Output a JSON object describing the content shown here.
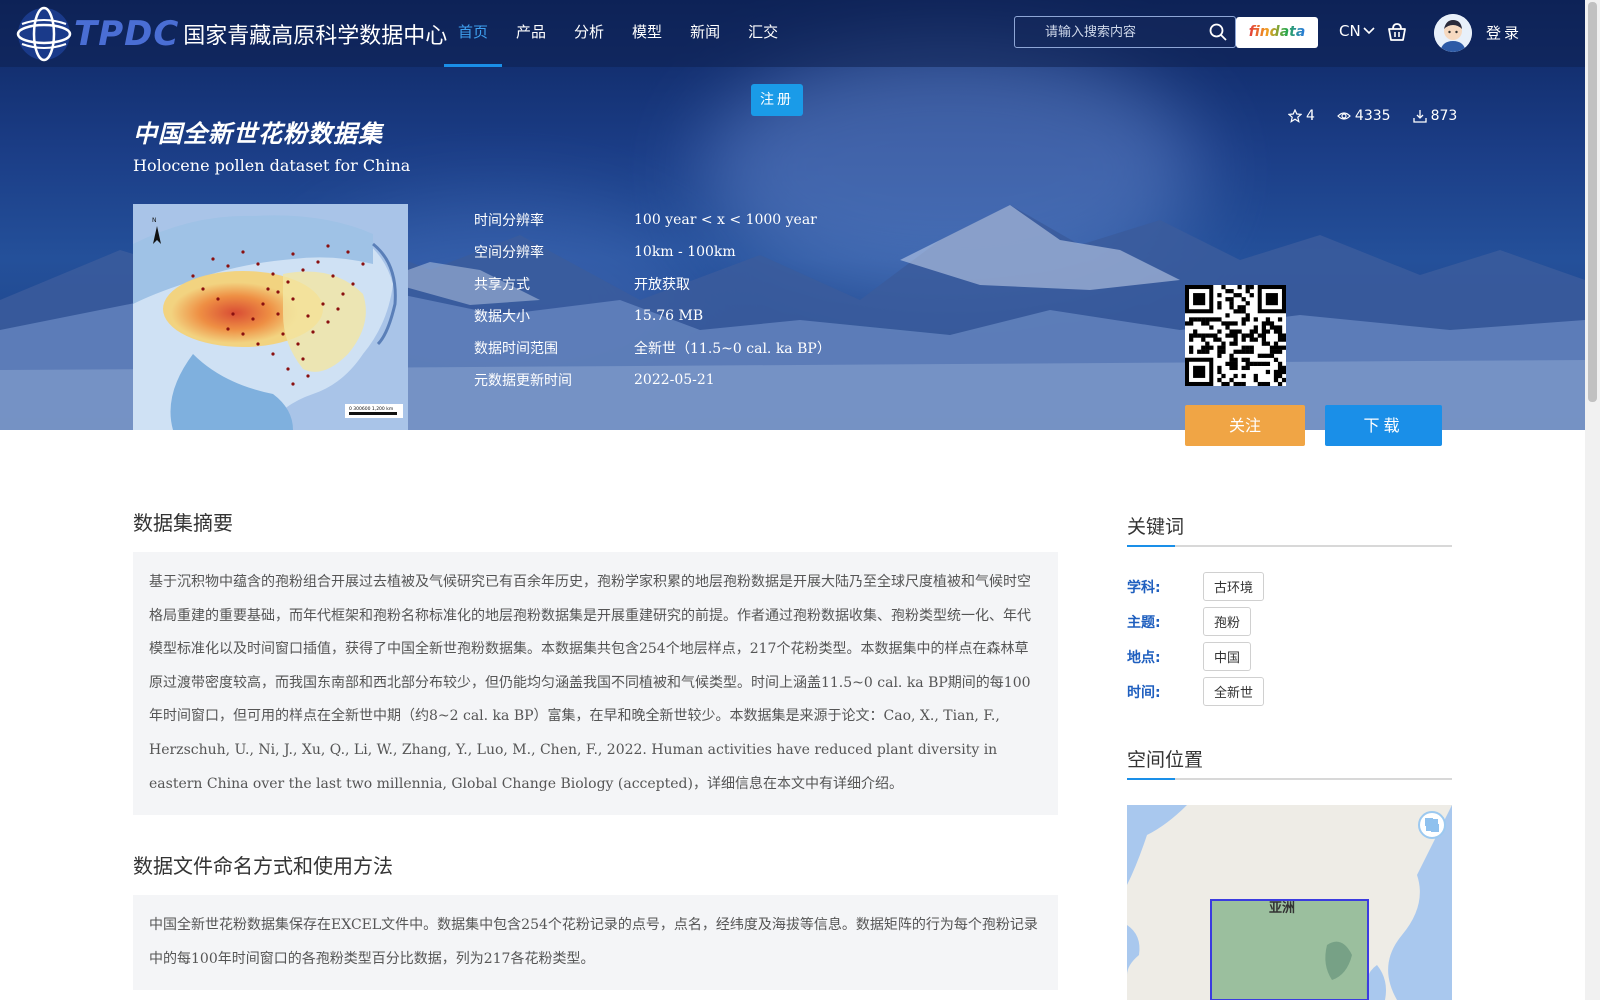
{
  "nav": {
    "logo_abbr": "TPDC",
    "logo_name": "国家青藏高原科学数据中心",
    "menu": [
      {
        "label": "首页",
        "active": true
      },
      {
        "label": "产品",
        "active": false
      },
      {
        "label": "分析",
        "active": false
      },
      {
        "label": "模型",
        "active": false
      },
      {
        "label": "新闻",
        "active": false
      },
      {
        "label": "汇交",
        "active": false
      }
    ],
    "search_placeholder": "请输入搜索内容",
    "findata_label": "findata",
    "lang": "CN",
    "login": "登录"
  },
  "register_label": "注册",
  "dataset": {
    "title_cn": "中国全新世花粉数据集",
    "title_en": "Holocene pollen dataset for China",
    "stars": "4",
    "views": "4335",
    "downloads": "873",
    "meta": [
      {
        "label": "时间分辨率",
        "value": "100 year < x < 1000 year"
      },
      {
        "label": "空间分辨率",
        "value": "10km - 100km"
      },
      {
        "label": "共享方式",
        "value": "开放获取"
      },
      {
        "label": "数据大小",
        "value": "15.76 MB"
      },
      {
        "label": "数据时间范围",
        "value": "全新世（11.5~0 cal. ka BP）"
      },
      {
        "label": "元数据更新时间",
        "value": "2022-05-21"
      }
    ],
    "thumb_scale": "0 300600 1,200 km",
    "follow_label": "关注",
    "download_label": "下载"
  },
  "abstract": {
    "title": "数据集摘要",
    "text": "基于沉积物中蕴含的孢粉组合开展过去植被及气候研究已有百余年历史，孢粉学家积累的地层孢粉数据是开展大陆乃至全球尺度植被和气候时空格局重建的重要基础，而年代框架和孢粉名称标准化的地层孢粉数据集是开展重建研究的前提。作者通过孢粉数据收集、孢粉类型统一化、年代模型标准化以及时间窗口插值，获得了中国全新世孢粉数据集。本数据集共包含254个地层样点，217个花粉类型。本数据集中的样点在森林草原过渡带密度较高，而我国东南部和西北部分布较少，但仍能均匀涵盖我国不同植被和气候类型。时间上涵盖11.5~0 cal. ka BP期间的每100年时间窗口，但可用的样点在全新世中期（约8~2 cal. ka BP）富集，在早和晚全新世较少。本数据集是来源于论文：Cao, X., Tian, F., Herzschuh, U., Ni, J., Xu, Q., Li, W., Zhang, Y., Luo, M., Chen, F., 2022. Human activities have reduced plant diversity in eastern China over the last two millennia, Global Change Biology (accepted)，详细信息在本文中有详细介绍。"
  },
  "usage": {
    "title": "数据文件命名方式和使用方法",
    "text": "中国全新世花粉数据集保存在EXCEL文件中。数据集中包含254个花粉记录的点号，点名，经纬度及海拔等信息。数据矩阵的行为每个孢粉记录中的每100年时间窗口的各孢粉类型百分比数据，列为217各花粉类型。"
  },
  "keywords": {
    "title": "关键词",
    "rows": [
      {
        "label": "学科:",
        "tag": "古环境"
      },
      {
        "label": "主题:",
        "tag": "孢粉"
      },
      {
        "label": "地点:",
        "tag": "中国"
      },
      {
        "label": "时间:",
        "tag": "全新世"
      }
    ]
  },
  "location": {
    "title": "空间位置",
    "map_label": "亚洲"
  }
}
